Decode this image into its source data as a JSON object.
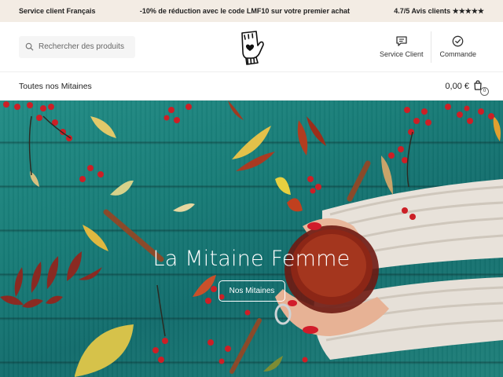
{
  "topbar": {
    "left": "Service client Français",
    "center": "-10% de réduction avec le code LMF10 sur votre premier achat",
    "right": "4.7/5 Avis clients ★★★★★"
  },
  "header": {
    "search_placeholder": "Rechercher des produits..",
    "logo_icon": "mitten-heart-logo",
    "actions": [
      {
        "label": "Service Client",
        "icon": "chat-bubble-icon"
      },
      {
        "label": "Commande",
        "icon": "check-circle-icon"
      }
    ]
  },
  "nav": {
    "link": "Toutes nos Mitaines",
    "cart_total": "0,00 €",
    "cart_count": "0"
  },
  "hero": {
    "title": "La Mitaine Femme",
    "button": "Nos Mitaines"
  },
  "colors": {
    "topbar_bg": "#f3ece4",
    "hero_teal": "#147a75",
    "accent_red": "#c8202a"
  }
}
